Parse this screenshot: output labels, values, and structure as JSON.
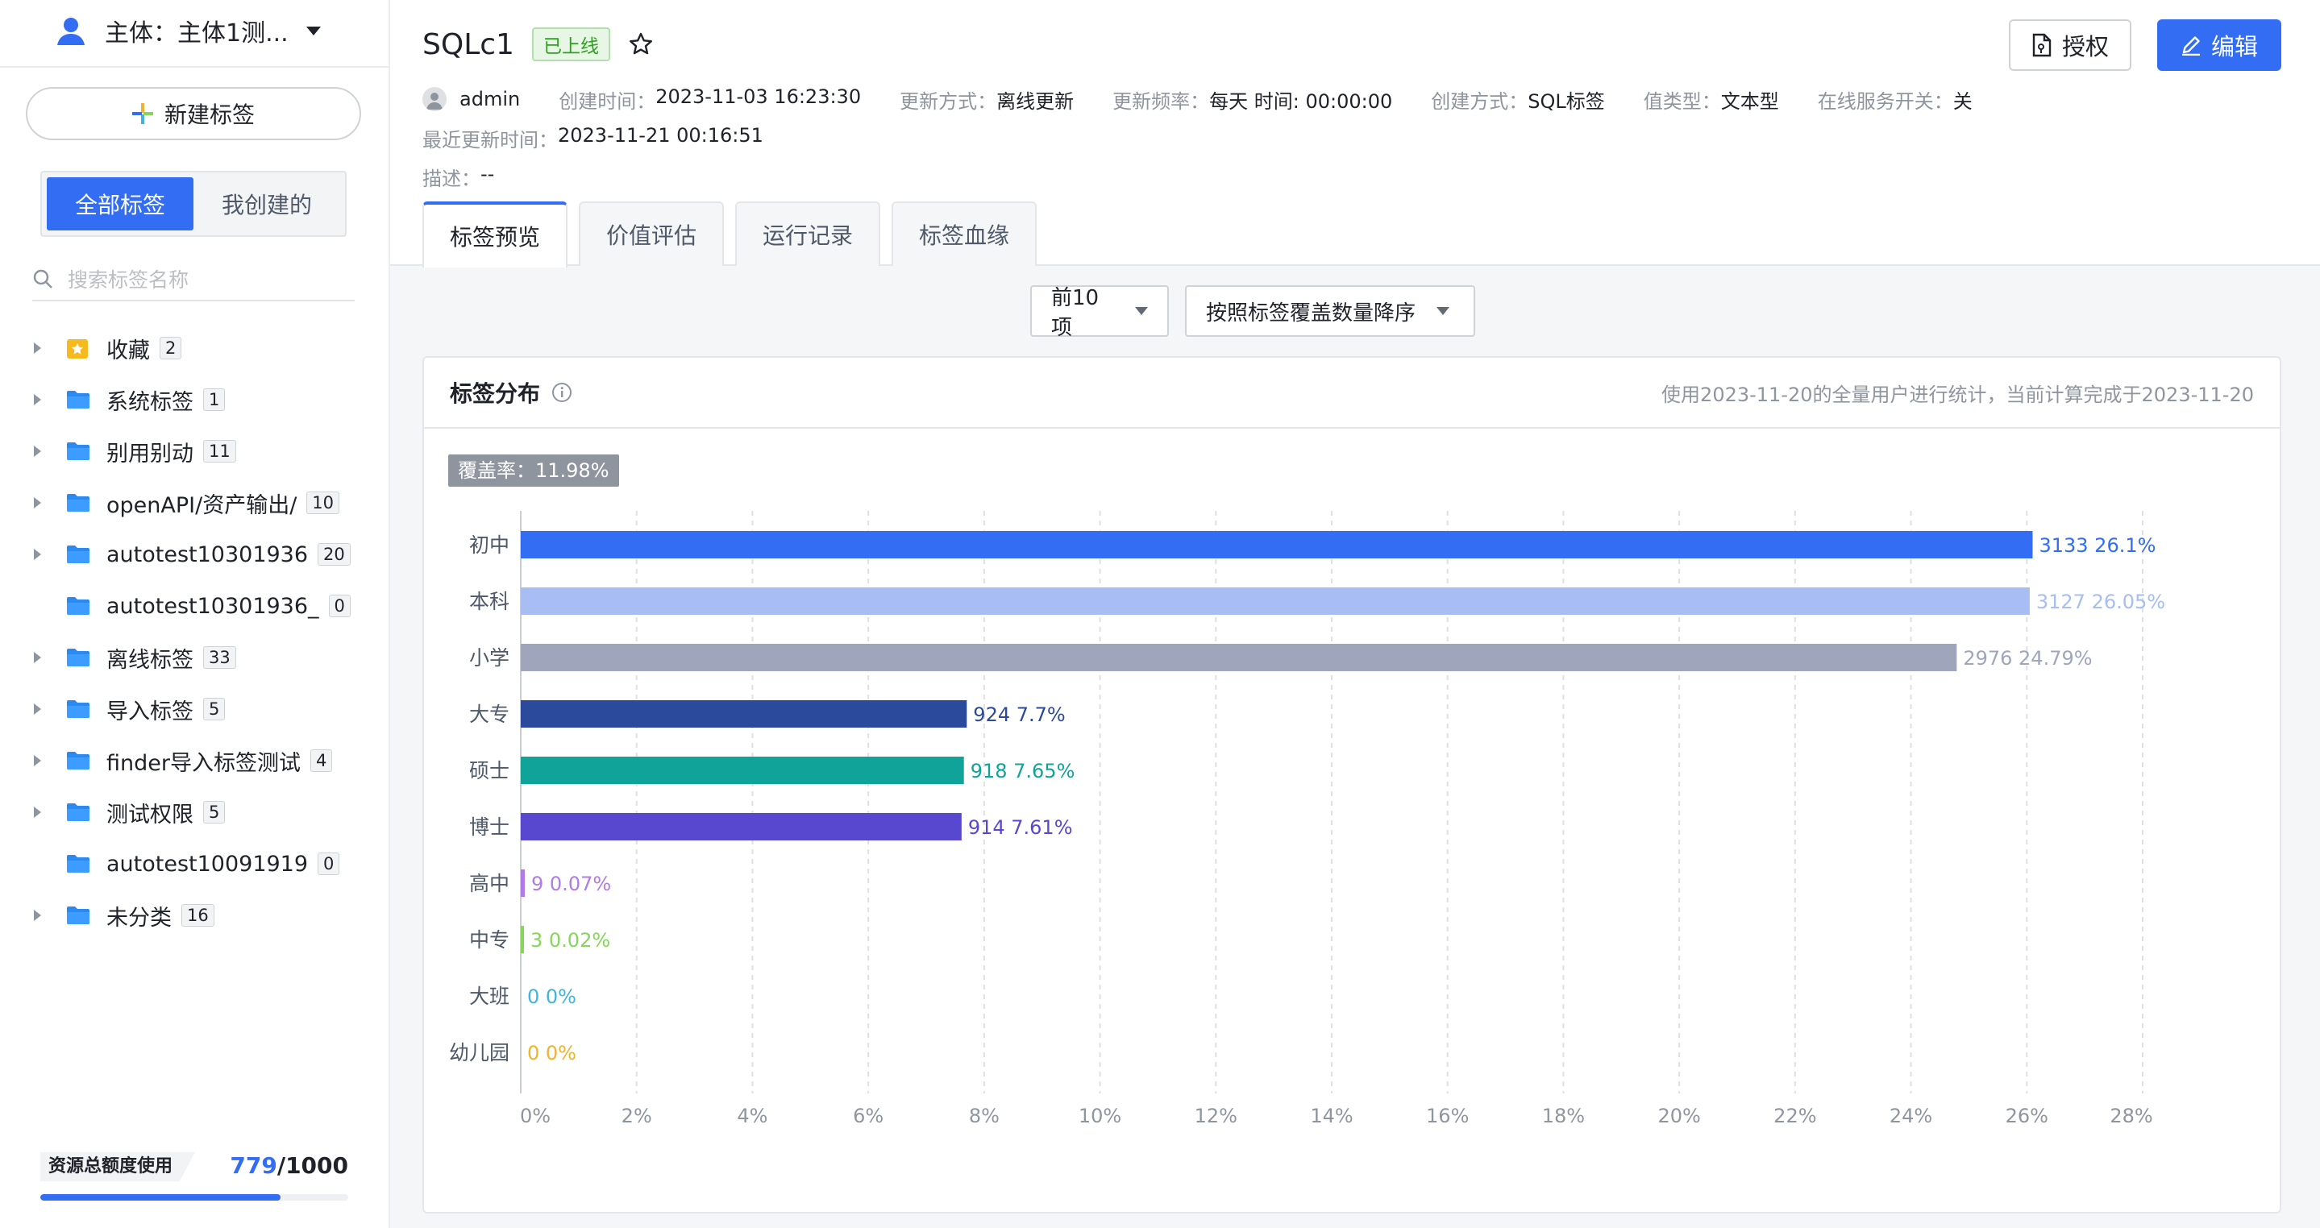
{
  "sidebar": {
    "subject": "主体：主体1测...",
    "new_tag": "新建标签",
    "seg": [
      "全部标签",
      "我创建的"
    ],
    "search_placeholder": "搜索标签名称",
    "items": [
      {
        "name": "收藏",
        "count": "2",
        "type": "star",
        "has_children": true
      },
      {
        "name": "系统标签",
        "count": "1",
        "type": "folder",
        "has_children": true
      },
      {
        "name": "别用别动",
        "count": "11",
        "type": "folder",
        "has_children": true
      },
      {
        "name": "openAPI/资产输出/",
        "count": "10",
        "type": "folder",
        "has_children": true
      },
      {
        "name": "autotest10301936",
        "count": "20",
        "type": "folder",
        "has_children": true
      },
      {
        "name": "autotest10301936_",
        "count": "0",
        "type": "folder",
        "has_children": false
      },
      {
        "name": "离线标签",
        "count": "33",
        "type": "folder",
        "has_children": true
      },
      {
        "name": "导入标签",
        "count": "5",
        "type": "folder",
        "has_children": true
      },
      {
        "name": "finder导入标签测试",
        "count": "4",
        "type": "folder",
        "has_children": true
      },
      {
        "name": "测试权限",
        "count": "5",
        "type": "folder",
        "has_children": true
      },
      {
        "name": "autotest10091919",
        "count": "0",
        "type": "folder",
        "has_children": false
      },
      {
        "name": "未分类",
        "count": "16",
        "type": "folder",
        "has_children": true
      }
    ],
    "quota": {
      "label": "资源总额度使用",
      "used": "779",
      "total": "/1000",
      "fraction": 0.779
    }
  },
  "header": {
    "title": "SQLc1",
    "status": "已上线",
    "auth_button": "授权",
    "edit_button": "编辑",
    "owner": "admin",
    "meta": [
      {
        "k": "创建时间：",
        "v": "2023-11-03 16:23:30"
      },
      {
        "k": "更新方式：",
        "v": "离线更新"
      },
      {
        "k": "更新频率：",
        "v": "每天 时间: 00:00:00"
      },
      {
        "k": "创建方式：",
        "v": "SQL标签"
      },
      {
        "k": "值类型：",
        "v": "文本型"
      },
      {
        "k": "在线服务开关：",
        "v": "关"
      }
    ],
    "last_update_k": "最近更新时间：",
    "last_update_v": "2023-11-21 00:16:51",
    "desc_k": "描述：",
    "desc_v": "--",
    "tabs": [
      "标签预览",
      "价值评估",
      "运行记录",
      "标签血缘"
    ]
  },
  "toolbar": {
    "top_n": "前10项",
    "sort": "按照标签覆盖数量降序"
  },
  "card": {
    "title": "标签分布",
    "note": "使用2023-11-20的全量用户进行统计，当前计算完成于2023-11-20",
    "coverage": "覆盖率：11.98%"
  },
  "colors": {
    "accent": "#336df4"
  },
  "chart_data": {
    "type": "bar",
    "orientation": "horizontal",
    "categories": [
      "初中",
      "本科",
      "小学",
      "大专",
      "硕士",
      "博士",
      "高中",
      "中专",
      "大班",
      "幼儿园"
    ],
    "values": [
      26.1,
      26.05,
      24.79,
      7.7,
      7.65,
      7.61,
      0.07,
      0.02,
      0,
      0
    ],
    "counts": [
      3133,
      3127,
      2976,
      924,
      918,
      914,
      9,
      3,
      0,
      0
    ],
    "labels": [
      "3133 26.1%",
      "3127 26.05%",
      "2976 24.79%",
      "924 7.7%",
      "918 7.65%",
      "914 7.61%",
      "9 0.07%",
      "3 0.02%",
      "0 0%",
      "0 0%"
    ],
    "colors": [
      "#336df4",
      "#a7bdf3",
      "#9fa6bb",
      "#2c4a9b",
      "#10a39a",
      "#5848cf",
      "#b07be6",
      "#86d65a",
      "#40b4de",
      "#f0b32b"
    ],
    "xlim": [
      0,
      28
    ],
    "xticks": [
      "0%",
      "2%",
      "4%",
      "6%",
      "8%",
      "10%",
      "12%",
      "14%",
      "16%",
      "18%",
      "20%",
      "22%",
      "24%",
      "26%",
      "28%"
    ],
    "grid": true
  }
}
